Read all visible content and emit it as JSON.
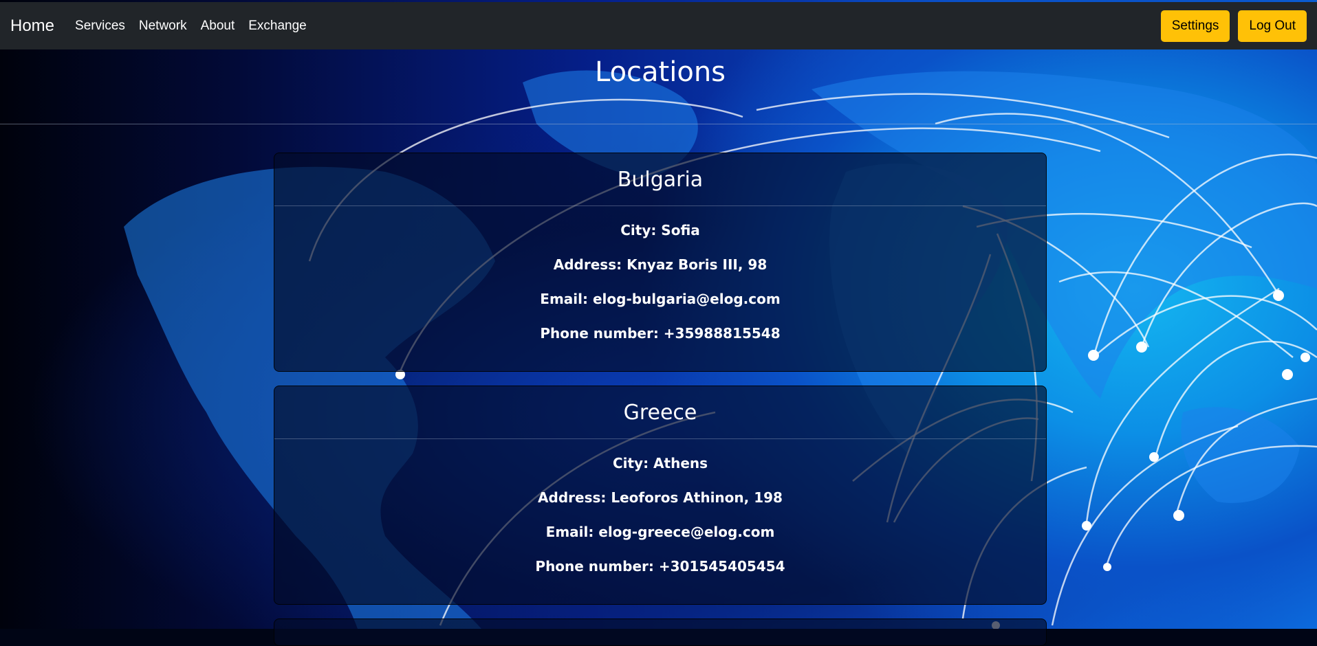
{
  "navbar": {
    "brand": "Home",
    "links": [
      "Services",
      "Network",
      "About",
      "Exchange"
    ],
    "settings_label": "Settings",
    "logout_label": "Log Out"
  },
  "page": {
    "title": "Locations"
  },
  "locations": [
    {
      "country": "Bulgaria",
      "city": "City: Sofia",
      "address": "Address: Knyaz Boris III, 98",
      "email": "Email: elog-bulgaria@elog.com",
      "phone": "Phone number: +35988815548"
    },
    {
      "country": "Greece",
      "city": "City: Athens",
      "address": "Address: Leoforos Athinon, 198",
      "email": "Email: elog-greece@elog.com",
      "phone": "Phone number: +301545405454"
    }
  ],
  "colors": {
    "navbar_bg": "#212529",
    "button_bg": "#ffc107",
    "background_accent": "#14b6f0"
  },
  "icons": {
    "background": "world-network-map-image"
  }
}
